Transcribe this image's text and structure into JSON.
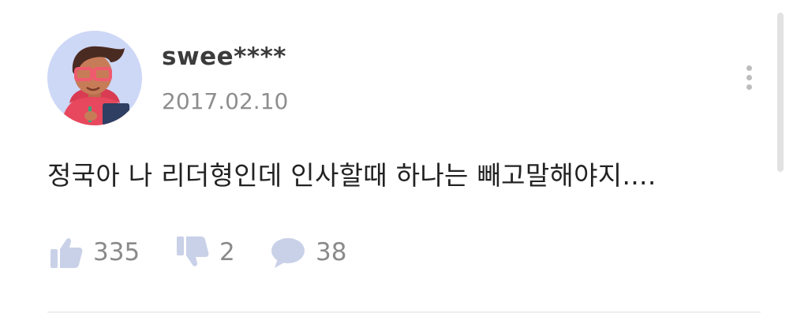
{
  "comment": {
    "username": "swee****",
    "date": "2017.02.10",
    "text": "정국아 나 리더형인데 인사할때 하나는 빼고말해야지....",
    "likes": "335",
    "dislikes": "2",
    "replies": "38"
  },
  "icons": {
    "avatar": "cartoon-avatar-with-glasses",
    "more": "vertical-dots-icon",
    "like": "thumbs-up-icon",
    "dislike": "thumbs-down-icon",
    "reply": "speech-bubble-icon"
  },
  "colors": {
    "icon": "#c9d1e8",
    "avatar_bg": "#cdd7f6",
    "hoodie": "#e8485d",
    "glasses": "#f05a6e"
  }
}
